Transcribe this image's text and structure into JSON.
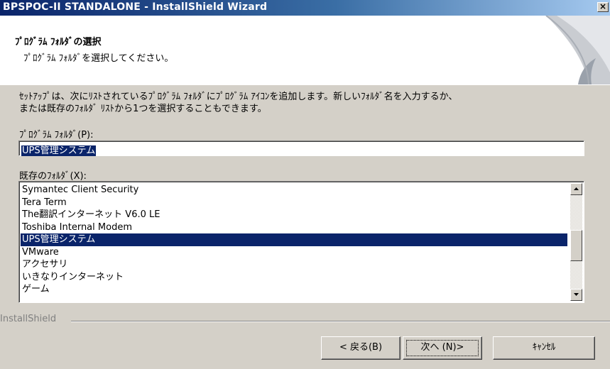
{
  "window": {
    "title": "BPSPOC-II STANDALONE - InstallShield Wizard",
    "close_label": "×"
  },
  "header": {
    "title": "ﾌﾟﾛｸﾞﾗﾑ ﾌｫﾙﾀﾞの選択",
    "subtitle": "ﾌﾟﾛｸﾞﾗﾑ ﾌｫﾙﾀﾞを選択してください。"
  },
  "description": {
    "line1": "ｾｯﾄｱｯﾌﾟは、次にﾘｽﾄされているﾌﾟﾛｸﾞﾗﾑ ﾌｫﾙﾀﾞにﾌﾟﾛｸﾞﾗﾑ ｱｲｺﾝを追加します。新しいﾌｫﾙﾀﾞ名を入力するか、",
    "line2": "または既存のﾌｫﾙﾀﾞ ﾘｽﾄから1つを選択することもできます。"
  },
  "program_folder": {
    "label": "ﾌﾟﾛｸﾞﾗﾑ ﾌｫﾙﾀﾞ(P):",
    "value": "UPS管理システム"
  },
  "existing_folders": {
    "label": "既存のﾌｫﾙﾀﾞ(X):",
    "items": [
      "Symantec Client Security",
      "Tera Term",
      "The翻訳インターネット V6.0 LE",
      "Toshiba Internal Modem",
      "UPS管理システム",
      "VMware",
      "アクセサリ",
      "いきなりインターネット",
      "ゲーム"
    ],
    "selected": "UPS管理システム"
  },
  "footer": {
    "brand": "InstallShield",
    "back_label": "< 戻る(B)",
    "next_label": "次へ (N)>",
    "cancel_label": "ｷｬﾝｾﾙ"
  },
  "colors": {
    "selection": "#0a246a",
    "face": "#d4d0c8"
  }
}
